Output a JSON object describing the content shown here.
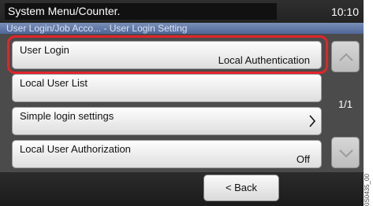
{
  "header": {
    "title": "System Menu/Counter.",
    "time": "10:10",
    "breadcrumb": "User Login/Job Acco... - User Login Setting"
  },
  "list": {
    "items": [
      {
        "label": "User Login",
        "value": "Local Authentication"
      },
      {
        "label": "Local User List",
        "value": ""
      },
      {
        "label": "Simple login settings",
        "value": ""
      },
      {
        "label": "Local User Authorization",
        "value": "Off"
      }
    ]
  },
  "pager": {
    "page": "1/1"
  },
  "footer": {
    "back_label": "< Back"
  },
  "side_code": "0S0435_00",
  "colors": {
    "highlight": "#e0252b",
    "breadcrumb_bg": "#5a71a3"
  },
  "icons": {
    "scroll_up": "chevron-up-icon",
    "scroll_down": "chevron-down-icon",
    "row_open": "chevron-right-icon"
  }
}
